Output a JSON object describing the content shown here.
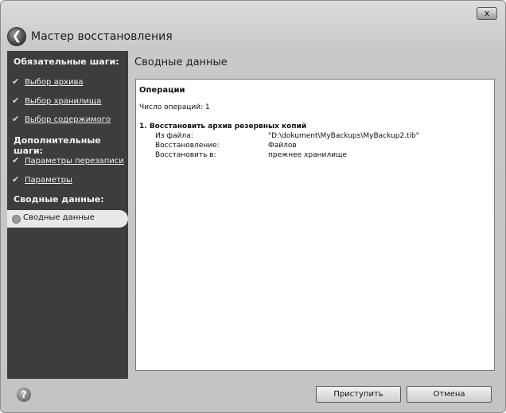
{
  "window": {
    "title": "Мастер восстановления",
    "close_label": "x"
  },
  "sidebar": {
    "section_required": "Обязательные шаги:",
    "required_items": [
      {
        "label": "Выбор архива"
      },
      {
        "label": "Выбор хранилища"
      },
      {
        "label": "Выбор содержимого"
      }
    ],
    "section_additional": "Дополнительные шаги:",
    "additional_items": [
      {
        "label": "Параметры перезаписи"
      },
      {
        "label": "Параметры"
      }
    ],
    "section_summary": "Сводные данные:",
    "active_item": "Сводные данные"
  },
  "main": {
    "panel_title": "Сводные данные",
    "operations_title": "Операции",
    "operations_count": "Число операций: 1",
    "step_title": "1. Восстановить архив резервных копий",
    "rows": [
      {
        "label": "Из файла:",
        "value": "\"D:\\dokument\\MyBackups\\MyBackup2.tib\""
      },
      {
        "label": "Восстановление:",
        "value": "Файлов"
      },
      {
        "label": "Восстановить в:",
        "value": "прежнее хранилище"
      }
    ]
  },
  "footer": {
    "proceed_label": "Приступить",
    "cancel_label": "Отмена"
  },
  "icons": [
    "back-arrow-icon",
    "close-icon",
    "checkmark-icon",
    "bullet-icon",
    "help-icon"
  ]
}
